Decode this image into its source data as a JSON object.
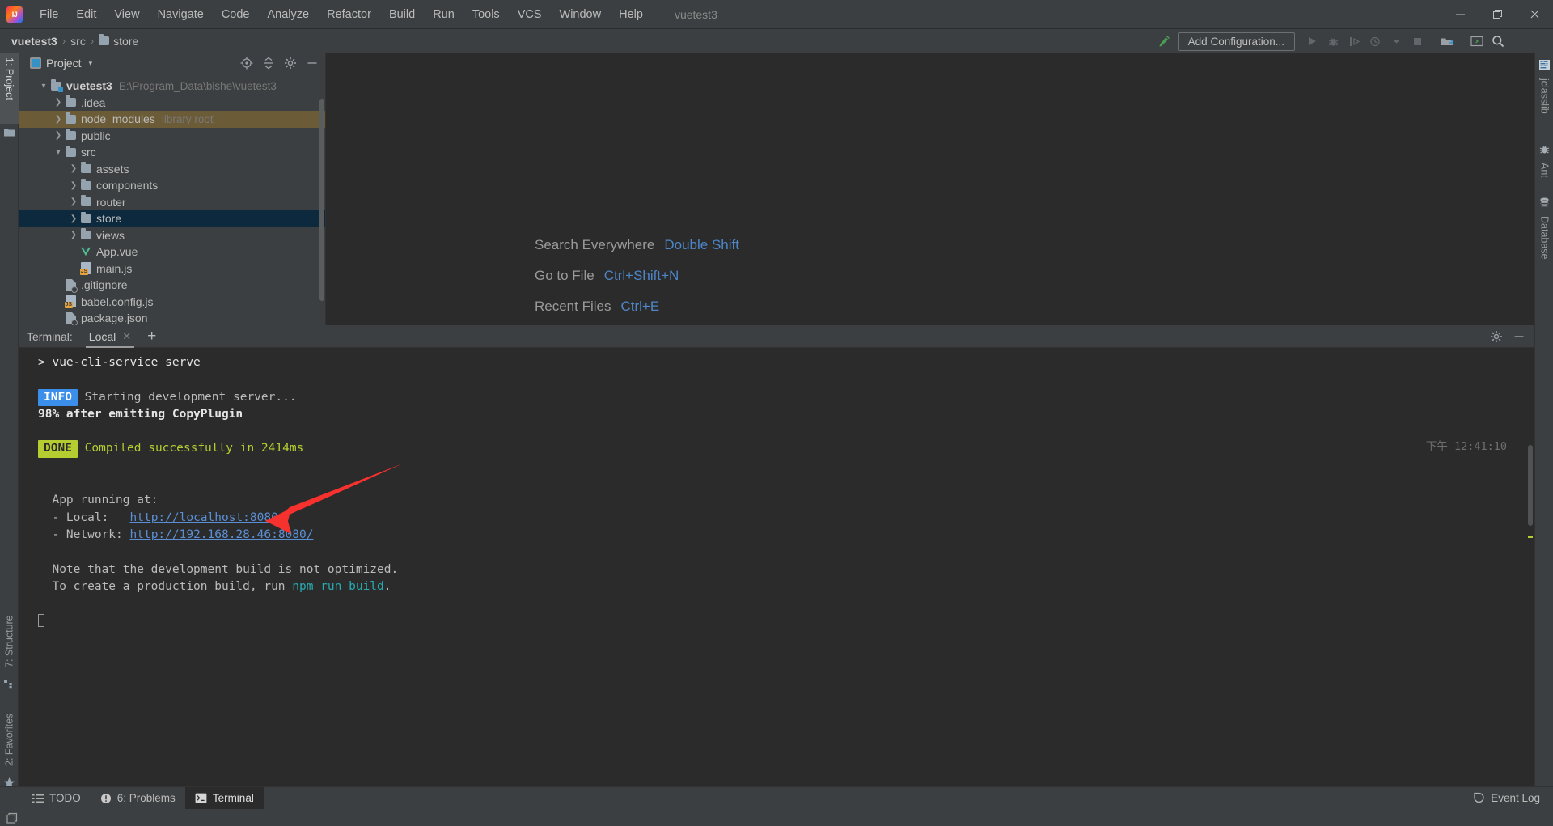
{
  "window": {
    "project_name": "vuetest3",
    "minimize": "—",
    "maximize": "❐",
    "close": "✕"
  },
  "menubar": {
    "logo_icon": "intellij-idea-logo",
    "items": [
      {
        "label": "File",
        "mnemonic": "F"
      },
      {
        "label": "Edit",
        "mnemonic": "E"
      },
      {
        "label": "View",
        "mnemonic": "V"
      },
      {
        "label": "Navigate",
        "mnemonic": "N"
      },
      {
        "label": "Code",
        "mnemonic": "C"
      },
      {
        "label": "Analyze",
        "mnemonic": "z"
      },
      {
        "label": "Refactor",
        "mnemonic": "R"
      },
      {
        "label": "Build",
        "mnemonic": "B"
      },
      {
        "label": "Run",
        "mnemonic": "u"
      },
      {
        "label": "Tools",
        "mnemonic": "T"
      },
      {
        "label": "VCS",
        "mnemonic": "S"
      },
      {
        "label": "Window",
        "mnemonic": "W"
      },
      {
        "label": "Help",
        "mnemonic": "H"
      }
    ]
  },
  "navbar": {
    "breadcrumbs": [
      {
        "label": "vuetest3",
        "icon": null
      },
      {
        "label": "src",
        "icon": null
      },
      {
        "label": "store",
        "icon": "folder-icon"
      }
    ],
    "separator": "›",
    "add_configuration_label": "Add Configuration...",
    "buttons": [
      {
        "name": "build-hammer-icon"
      },
      {
        "name": "run-button"
      },
      {
        "name": "debug-button"
      },
      {
        "name": "run-coverage-button"
      },
      {
        "name": "profile-button"
      },
      {
        "name": "stop-button"
      },
      {
        "name": "project-structure-button"
      },
      {
        "name": "terminal-button"
      },
      {
        "name": "search-everywhere-button"
      }
    ]
  },
  "left_strip": {
    "tabs": [
      {
        "label": "1: Project",
        "icon": "project-folder-icon",
        "selected": true
      }
    ],
    "bottom_tabs": [
      {
        "label": "7: Structure",
        "icon": "structure-icon"
      },
      {
        "label": "2: Favorites",
        "icon": "star-icon"
      }
    ]
  },
  "right_strip": {
    "tabs": [
      {
        "label": "jclasslib",
        "icon": "jclasslib-icon"
      },
      {
        "label": "Ant",
        "icon": "ant-bug-icon"
      },
      {
        "label": "Database",
        "icon": "database-icon"
      }
    ]
  },
  "project_panel": {
    "title": "Project",
    "view_dropdown_caret": "▾",
    "actions": [
      {
        "name": "locate-in-tree-icon"
      },
      {
        "name": "collapse-all-icon"
      },
      {
        "name": "settings-gear-icon"
      },
      {
        "name": "hide-panel-icon"
      }
    ],
    "tree": [
      {
        "label": "vuetest3",
        "sub": "E:\\Program_Data\\bishe\\vuetest3",
        "depth": 0,
        "arrow": "expanded",
        "icon": "module-folder-icon",
        "bold": true,
        "state": "normal"
      },
      {
        "label": ".idea",
        "sub": "",
        "depth": 1,
        "arrow": "collapsed",
        "icon": "folder-icon",
        "bold": false,
        "state": "normal"
      },
      {
        "label": "node_modules",
        "sub": "library root",
        "depth": 1,
        "arrow": "collapsed",
        "icon": "folder-icon",
        "bold": false,
        "state": "library"
      },
      {
        "label": "public",
        "sub": "",
        "depth": 1,
        "arrow": "collapsed",
        "icon": "folder-icon",
        "bold": false,
        "state": "normal"
      },
      {
        "label": "src",
        "sub": "",
        "depth": 1,
        "arrow": "expanded",
        "icon": "folder-icon",
        "bold": false,
        "state": "normal"
      },
      {
        "label": "assets",
        "sub": "",
        "depth": 2,
        "arrow": "collapsed",
        "icon": "folder-icon",
        "bold": false,
        "state": "normal"
      },
      {
        "label": "components",
        "sub": "",
        "depth": 2,
        "arrow": "collapsed",
        "icon": "folder-icon",
        "bold": false,
        "state": "normal"
      },
      {
        "label": "router",
        "sub": "",
        "depth": 2,
        "arrow": "collapsed",
        "icon": "folder-icon",
        "bold": false,
        "state": "normal"
      },
      {
        "label": "store",
        "sub": "",
        "depth": 2,
        "arrow": "collapsed",
        "icon": "folder-icon",
        "bold": false,
        "state": "selected"
      },
      {
        "label": "views",
        "sub": "",
        "depth": 2,
        "arrow": "collapsed",
        "icon": "folder-icon",
        "bold": false,
        "state": "normal"
      },
      {
        "label": "App.vue",
        "sub": "",
        "depth": 2,
        "arrow": "none",
        "icon": "vue-file-icon",
        "bold": false,
        "state": "normal"
      },
      {
        "label": "main.js",
        "sub": "",
        "depth": 2,
        "arrow": "none",
        "icon": "js-file-icon",
        "bold": false,
        "state": "normal"
      },
      {
        "label": ".gitignore",
        "sub": "",
        "depth": 1,
        "arrow": "none",
        "icon": "gitignore-file-icon",
        "bold": false,
        "state": "normal"
      },
      {
        "label": "babel.config.js",
        "sub": "",
        "depth": 1,
        "arrow": "none",
        "icon": "js-file-icon",
        "bold": false,
        "state": "normal"
      },
      {
        "label": "package.json",
        "sub": "",
        "depth": 1,
        "arrow": "none",
        "icon": "json-file-icon",
        "bold": false,
        "state": "normal"
      }
    ]
  },
  "editor": {
    "hints": [
      {
        "label": "Search Everywhere",
        "key": "Double Shift"
      },
      {
        "label": "Go to File",
        "key": "Ctrl+Shift+N"
      },
      {
        "label": "Recent Files",
        "key": "Ctrl+E"
      }
    ]
  },
  "terminal": {
    "label": "Terminal:",
    "tab_name": "Local",
    "tab_close": "✕",
    "new_tab": "+",
    "header_buttons": [
      {
        "name": "settings-gear-icon"
      },
      {
        "name": "hide-panel-icon"
      }
    ],
    "timestamp": "下午 12:41:10",
    "lines": [
      {
        "type": "plain",
        "segments": [
          {
            "text": "> vue-cli-service serve",
            "style": "white"
          }
        ]
      },
      {
        "type": "blank",
        "segments": []
      },
      {
        "type": "tagged",
        "tag": "INFO",
        "tag_style": "info",
        "segments": [
          {
            "text": "Starting development server...",
            "style": "grey"
          }
        ]
      },
      {
        "type": "plain",
        "segments": [
          {
            "text": "98% after emitting CopyPlugin",
            "style": "white-bold"
          }
        ]
      },
      {
        "type": "blank",
        "segments": []
      },
      {
        "type": "tagged",
        "tag": "DONE",
        "tag_style": "done",
        "segments": [
          {
            "text": "Compiled successfully in 2414ms",
            "style": "green"
          }
        ]
      },
      {
        "type": "blank",
        "segments": []
      },
      {
        "type": "blank",
        "segments": []
      },
      {
        "type": "plain",
        "segments": [
          {
            "text": "  App running at:",
            "style": "grey"
          }
        ]
      },
      {
        "type": "plain",
        "segments": [
          {
            "text": "  - Local:   ",
            "style": "grey"
          },
          {
            "text": "http://localhost:8080/",
            "style": "link"
          }
        ]
      },
      {
        "type": "plain",
        "segments": [
          {
            "text": "  - Network: ",
            "style": "grey"
          },
          {
            "text": "http://192.168.28.46:8080/",
            "style": "link"
          }
        ]
      },
      {
        "type": "blank",
        "segments": []
      },
      {
        "type": "plain",
        "segments": [
          {
            "text": "  Note that the development build is not optimized.",
            "style": "grey"
          }
        ]
      },
      {
        "type": "plain",
        "segments": [
          {
            "text": "  To create a production build, run ",
            "style": "grey"
          },
          {
            "text": "npm run build",
            "style": "teal"
          },
          {
            "text": ".",
            "style": "grey"
          }
        ]
      },
      {
        "type": "blank",
        "segments": []
      },
      {
        "type": "caret",
        "segments": []
      }
    ]
  },
  "annotation": {
    "arrow_color": "#f7312e",
    "points_to": "http://localhost:8080/"
  },
  "bottom_bar": {
    "tabs": [
      {
        "label": "TODO",
        "icon": "todo-list-icon",
        "active": false,
        "mnemonic": ""
      },
      {
        "label": "6: Problems",
        "icon": "problems-warning-icon",
        "active": false,
        "mnemonic": "6"
      },
      {
        "label": "Terminal",
        "icon": "terminal-icon",
        "active": true,
        "mnemonic": ""
      }
    ],
    "event_log": {
      "label": "Event Log",
      "icon": "event-log-balloon-icon"
    }
  },
  "status_bar": {
    "icon": "show-layout-icon"
  },
  "colors": {
    "panel_bg": "#3c3f41",
    "editor_bg": "#2b2b2b",
    "selection": "#0d293e",
    "library_highlight": "#6b5b36",
    "accent_blue": "#3592c4",
    "link": "#5b8fd4",
    "done_green": "#b5cd30",
    "info_blue": "#3b8eea",
    "arrow_red": "#f7312e"
  }
}
